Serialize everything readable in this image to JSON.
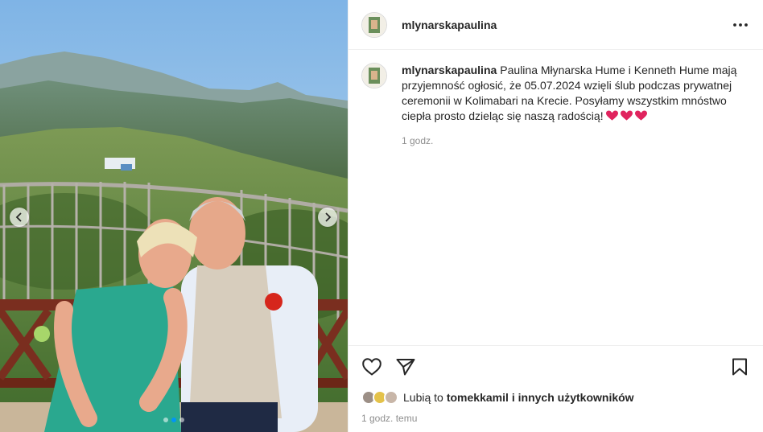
{
  "post": {
    "username": "mlynarskapaulina",
    "caption_text": "Paulina Młynarska Hume i Kenneth Hume mają przyjemność ogłosić, że 05.07.2024 wzięli ślub podczas prywatnej ceremonii w Kolimabari na Krecie. Posyłamy wszystkim mnóstwo ciepła prosto dzieląc się naszą radością!",
    "caption_time": "1 godz.",
    "likes_prefix": "Lubią to",
    "likes_user": "tomekkamil",
    "likes_suffix": "i innych użytkowników",
    "posted_time": "1 godz. temu"
  },
  "media": {
    "carousel_count": 3,
    "active_index": 1
  },
  "icons": {
    "more": "more-options-icon",
    "like": "heart-icon",
    "share": "paper-plane-icon",
    "save": "bookmark-icon",
    "prev": "chevron-left-icon",
    "next": "chevron-right-icon"
  },
  "colors": {
    "heart_emoji": "#e0245e",
    "active_dot": "#0095f6",
    "secondary_text": "#8e8e8e"
  }
}
